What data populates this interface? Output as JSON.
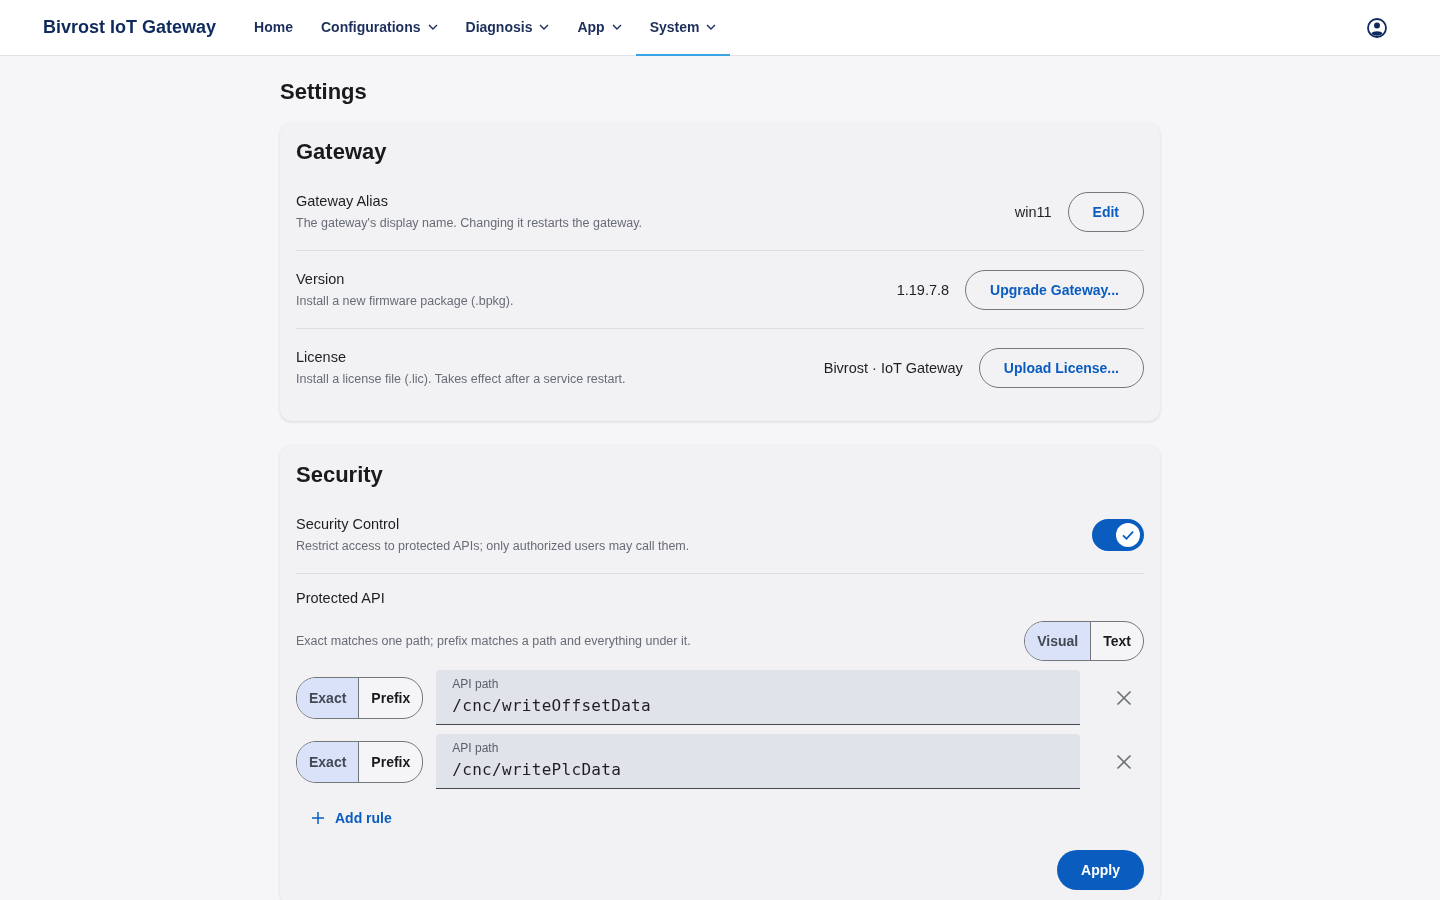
{
  "header": {
    "brand": "Bivrost IoT Gateway",
    "nav": [
      {
        "label": "Home",
        "dropdown": false,
        "selected": false
      },
      {
        "label": "Configurations",
        "dropdown": true,
        "selected": false
      },
      {
        "label": "Diagnosis",
        "dropdown": true,
        "selected": false
      },
      {
        "label": "App",
        "dropdown": true,
        "selected": false
      },
      {
        "label": "System",
        "dropdown": true,
        "selected": true
      }
    ]
  },
  "page_title": "Settings",
  "gateway": {
    "title": "Gateway",
    "rows": [
      {
        "label": "Gateway Alias",
        "description": "The gateway's display name. Changing it restarts the gateway.",
        "value": "win11",
        "button": "Edit"
      },
      {
        "label": "Version",
        "description": "Install a new firmware package (.bpkg).",
        "value": "1.19.7.8",
        "button": "Upgrade Gateway..."
      },
      {
        "label": "License",
        "description": "Install a license file (.lic). Takes effect after a service restart.",
        "value": "Bivrost · IoT Gateway",
        "button": "Upload License..."
      }
    ]
  },
  "security": {
    "title": "Security",
    "control": {
      "label": "Security Control",
      "description": "Restrict access to protected APIs; only authorized users may call them.",
      "on": true
    },
    "protected_api": {
      "label": "Protected API",
      "description": "Exact matches one path; prefix matches a path and everything under it.",
      "modes": [
        {
          "label": "Visual",
          "selected": true
        },
        {
          "label": "Text",
          "selected": false
        }
      ],
      "rules": [
        {
          "match": [
            {
              "label": "Exact",
              "selected": true
            },
            {
              "label": "Prefix",
              "selected": false
            }
          ],
          "field_label": "API path",
          "value": "/cnc/writeOffsetData"
        },
        {
          "match": [
            {
              "label": "Exact",
              "selected": true
            },
            {
              "label": "Prefix",
              "selected": false
            }
          ],
          "field_label": "API path",
          "value": "/cnc/writePlcData"
        }
      ],
      "add_button": "Add rule"
    },
    "apply_button": "Apply"
  }
}
